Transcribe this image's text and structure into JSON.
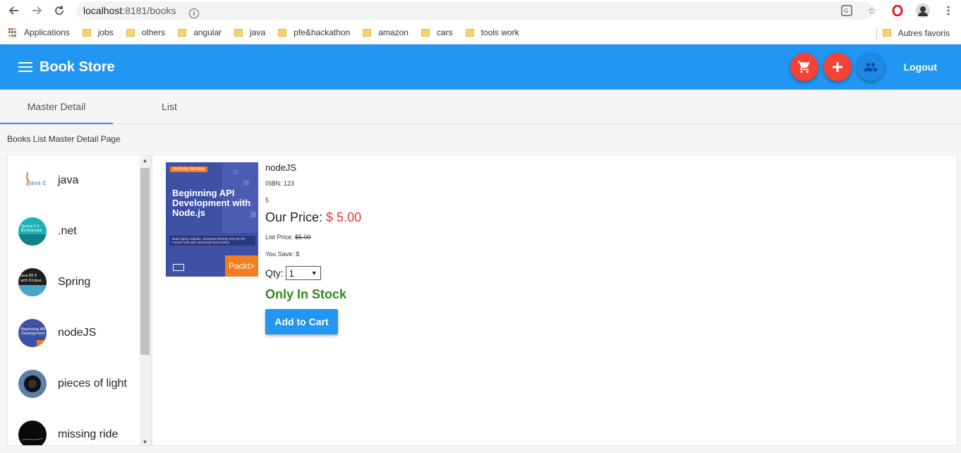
{
  "browser": {
    "url_host": "localhost",
    "url_rest": ":8181/books",
    "bookmarks": [
      "Applications",
      "jobs",
      "others",
      "angular",
      "java",
      "pfe&hackathon",
      "amazon",
      "cars",
      "tools work"
    ],
    "other_bookmarks": "Autres favoris"
  },
  "app_bar": {
    "title": "Book Store",
    "logout_label": "Logout",
    "color": "#2196f3"
  },
  "tabs": [
    {
      "label": "Master Detail",
      "active": true
    },
    {
      "label": "List",
      "active": false
    }
  ],
  "page_heading": "Books List Master Detail Page",
  "book_list": [
    {
      "label": "java"
    },
    {
      "label": ".net"
    },
    {
      "label": "Spring"
    },
    {
      "label": "nodeJS"
    },
    {
      "label": "pieces of light"
    },
    {
      "label": "missing ride"
    }
  ],
  "detail": {
    "cover": {
      "author": "Anthony Nandaa",
      "title": "Beginning API Development with Node.js",
      "description": "Build highly scalable, developer-friendly APIs for the modern web with JavaScript and Node.js",
      "publisher": "Packt>"
    },
    "title": "nodeJS",
    "isbn": "ISBN: 123",
    "rating": "5",
    "our_price_label": "Our Price:",
    "our_price_value": "$ 5.00",
    "list_price_label": "List Price:",
    "list_price_value": "$5.00",
    "you_save": "You Save: $",
    "qty_label": "Qty:",
    "qty_value": "1",
    "stock_text": "Only In Stock",
    "add_to_cart_label": "Add to Cart"
  }
}
